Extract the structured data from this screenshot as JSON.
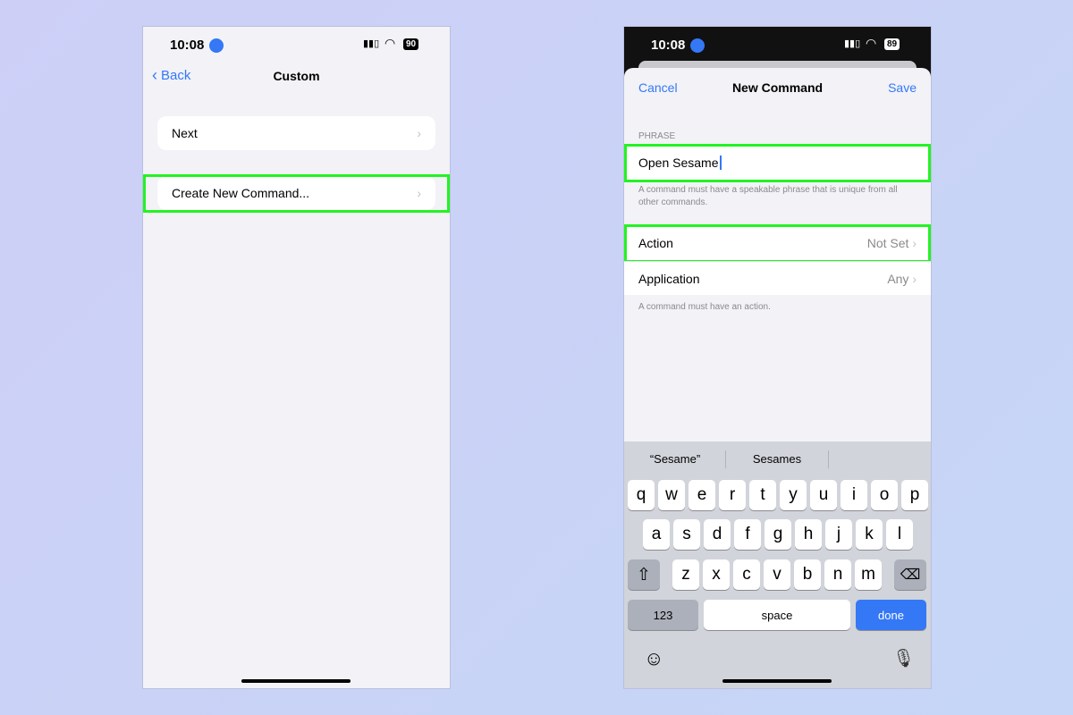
{
  "left": {
    "status": {
      "time": "10:08",
      "battery": "90"
    },
    "nav": {
      "back": "Back",
      "title": "Custom"
    },
    "items": [
      {
        "label": "Next"
      },
      {
        "label": "Create New Command..."
      }
    ]
  },
  "right": {
    "status": {
      "time": "10:08",
      "battery": "89"
    },
    "nav": {
      "cancel": "Cancel",
      "title": "New Command",
      "save": "Save"
    },
    "phrase_header": "PHRASE",
    "phrase_value": "Open Sesame",
    "phrase_note": "A command must have a speakable phrase that is unique from all other commands.",
    "rows": [
      {
        "label": "Action",
        "value": "Not Set"
      },
      {
        "label": "Application",
        "value": "Any"
      }
    ],
    "action_note": "A command must have an action.",
    "keyboard": {
      "suggestions": [
        "“Sesame”",
        "Sesames"
      ],
      "row1": [
        "q",
        "w",
        "e",
        "r",
        "t",
        "y",
        "u",
        "i",
        "o",
        "p"
      ],
      "row2": [
        "a",
        "s",
        "d",
        "f",
        "g",
        "h",
        "j",
        "k",
        "l"
      ],
      "row3": [
        "z",
        "x",
        "c",
        "v",
        "b",
        "n",
        "m"
      ],
      "numbers": "123",
      "space": "space",
      "done": "done"
    }
  },
  "colors": {
    "accent": "#3478f6",
    "highlight": "#22f422"
  }
}
